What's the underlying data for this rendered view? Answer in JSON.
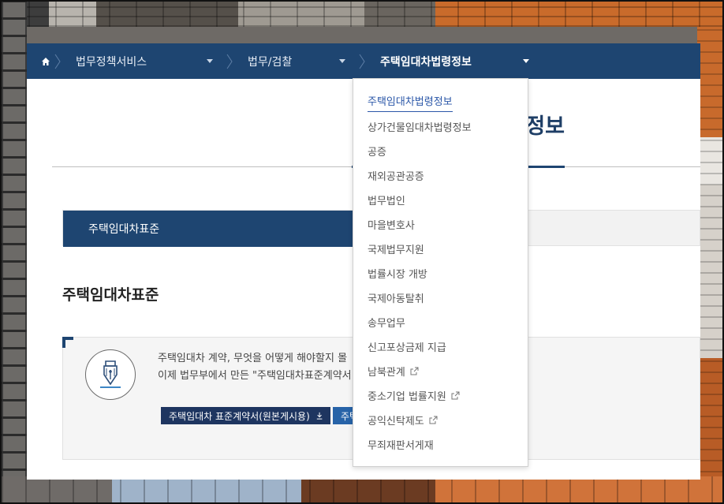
{
  "breadcrumb": {
    "home_icon": "home-icon",
    "items": [
      {
        "label": "법무정책서비스"
      },
      {
        "label": "법무/검찰"
      },
      {
        "label": "주택임대차법령정보"
      }
    ]
  },
  "page": {
    "title": "주택임대차법령정보"
  },
  "tabs": {
    "active_label": "주택임대차표준"
  },
  "section": {
    "title": "주택임대차표준"
  },
  "info": {
    "line1": "주택임대차 계약, 무엇을 어떻게 해야할지 몰",
    "line2": "이제 법무부에서 만든 \"주택임대차표준계약서",
    "download_button_label": "주택임대차 표준계약서(원본게시용)",
    "second_button_label": "주택"
  },
  "dropdown": {
    "items": [
      {
        "label": "주택임대차법령정보",
        "external": false
      },
      {
        "label": "상가건물임대차법령정보",
        "external": false
      },
      {
        "label": "공증",
        "external": false
      },
      {
        "label": "재외공관공증",
        "external": false
      },
      {
        "label": "법무법인",
        "external": false
      },
      {
        "label": "마을변호사",
        "external": false
      },
      {
        "label": "국제법무지원",
        "external": false
      },
      {
        "label": "법률시장 개방",
        "external": false
      },
      {
        "label": "국제아동탈취",
        "external": false
      },
      {
        "label": "송무업무",
        "external": false
      },
      {
        "label": "신고포상금제 지급",
        "external": false
      },
      {
        "label": "남북관계",
        "external": true
      },
      {
        "label": "중소기업 법률지원",
        "external": true
      },
      {
        "label": "공익신탁제도",
        "external": true
      },
      {
        "label": "무죄재판서게재",
        "external": false
      }
    ]
  },
  "colors": {
    "navy": "#1e4571",
    "link_blue": "#2b57a8"
  }
}
